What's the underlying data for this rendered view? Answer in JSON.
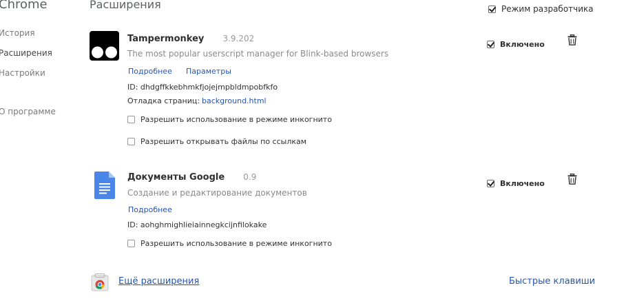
{
  "sidebar": {
    "title": "Chrome",
    "items": [
      {
        "label": "История"
      },
      {
        "label": "Расширения"
      },
      {
        "label": "Настройки"
      },
      {
        "label": "О программе"
      }
    ]
  },
  "main": {
    "title": "Расширения",
    "dev_mode_label": "Режим разработчика",
    "extensions": [
      {
        "name": "Tampermonkey",
        "version": "3.9.202",
        "description": "The most popular userscript manager for Blink-based browsers",
        "details_link": "Подробнее",
        "options_link": "Параметры",
        "id_text": "ID: dhdgffkkebhmkfjojejmpbldmpobfkfo",
        "inspect_label": "Отладка страниц:",
        "inspect_link": "background.html",
        "incognito_label": "Разрешить использование в режиме инкогнито",
        "file_urls_label": "Разрешить открывать файлы по ссылкам",
        "enabled_label": "Включено"
      },
      {
        "name": "Документы Google",
        "version": "0.9",
        "description": "Создание и редактирование документов",
        "details_link": "Подробнее",
        "id_text": "ID: aohghmighlieiainnegkcijnfilokake",
        "incognito_label": "Разрешить использование в режиме инкогнито",
        "enabled_label": "Включено"
      }
    ],
    "more_extensions_link": "Ещё расширения",
    "shortcuts_link": "Быстрые клавиши"
  }
}
